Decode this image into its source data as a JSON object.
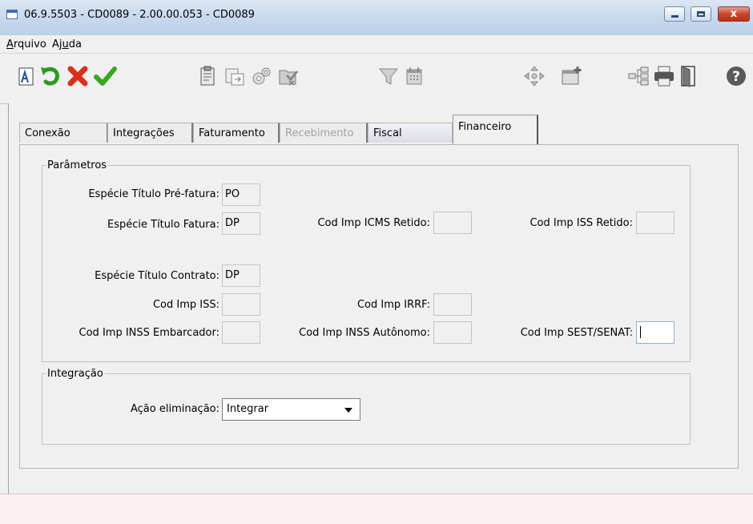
{
  "window": {
    "title": "06.9.5503 - CD0089 - 2.00.00.053 - CD0089",
    "close_glyph": "x"
  },
  "menu": {
    "arquivo": {
      "underlined": "A",
      "rest": "rquivo"
    },
    "ajuda": {
      "before": "Aj",
      "underlined": "u",
      "after": "da"
    }
  },
  "toolbar": {
    "icons": [
      "text-format-icon",
      "undo-icon",
      "cancel-icon",
      "confirm-icon",
      "clipboard-icon",
      "copy-window-icon",
      "gears-icon",
      "document-check-icon",
      "filter-icon",
      "calendar-icon",
      "navigate-icon",
      "new-window-icon",
      "tree-icon",
      "print-icon",
      "exit-door-icon",
      "help-icon"
    ]
  },
  "tabs": [
    {
      "label": "Conexão",
      "state": "normal"
    },
    {
      "label": "Integrações",
      "state": "normal"
    },
    {
      "label": "Faturamento",
      "state": "normal"
    },
    {
      "label": "Recebimento",
      "state": "disabled"
    },
    {
      "label": "Fiscal",
      "state": "normal"
    },
    {
      "label": "Financeiro",
      "state": "active"
    }
  ],
  "parametros": {
    "legend": "Parâmetros",
    "especie_pre_fatura": {
      "label": "Espécie Título Pré-fatura:",
      "value": "PO"
    },
    "especie_fatura": {
      "label": "Espécie Título Fatura:",
      "value": "DP"
    },
    "cod_icms_retido": {
      "label": "Cod Imp ICMS Retido:",
      "value": ""
    },
    "cod_iss_retido": {
      "label": "Cod Imp ISS Retido:",
      "value": ""
    },
    "especie_contrato": {
      "label": "Espécie Título Contrato:",
      "value": "DP"
    },
    "cod_iss": {
      "label": "Cod Imp ISS:",
      "value": ""
    },
    "cod_irrf": {
      "label": "Cod Imp IRRF:",
      "value": ""
    },
    "cod_inss_embarcador": {
      "label": "Cod Imp INSS Embarcador:",
      "value": ""
    },
    "cod_inss_autonomo": {
      "label": "Cod Imp INSS Autônomo:",
      "value": ""
    },
    "cod_sest_senat": {
      "label": "Cod Imp SEST/SENAT:",
      "value": ""
    }
  },
  "integracao": {
    "legend": "Integração",
    "acao_eliminacao": {
      "label": "Ação eliminação:",
      "selected": "Integrar"
    }
  },
  "colors": {
    "window_bg": "#f0f0f0",
    "titlebar": "#c9daee",
    "status_bg": "#fbf1f0",
    "close_red": "#c8452b"
  }
}
